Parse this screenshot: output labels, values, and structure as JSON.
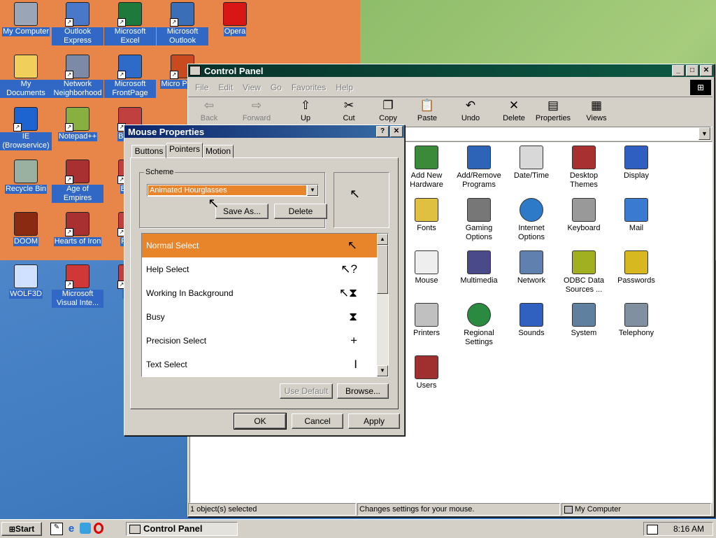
{
  "desktop": {
    "icons": [
      {
        "label": "My Computer",
        "icon": "computer-icon"
      },
      {
        "label": "Outlook Express",
        "icon": "outlook-express-icon"
      },
      {
        "label": "Microsoft Excel",
        "icon": "excel-icon"
      },
      {
        "label": "Microsoft Outlook",
        "icon": "outlook-icon"
      },
      {
        "label": "Opera",
        "icon": "opera-icon"
      },
      {
        "label": "My Documents",
        "icon": "folder-icon"
      },
      {
        "label": "Network Neighborhood",
        "icon": "network-icon"
      },
      {
        "label": "Microsoft FrontPage",
        "icon": "frontpage-icon"
      },
      {
        "label": "Micro Power",
        "icon": "powerpoint-icon"
      },
      {
        "label": "IE (Browservice)",
        "icon": "ie-icon"
      },
      {
        "label": "Notepad++",
        "icon": "notepad-icon"
      },
      {
        "label": "Bete D",
        "icon": "app-icon"
      },
      {
        "label": "Recycle Bin",
        "icon": "recycle-bin-icon"
      },
      {
        "label": "Age of Empires",
        "icon": "game-icon"
      },
      {
        "label": "Big D",
        "icon": "app-icon"
      },
      {
        "label": "DOOM",
        "icon": "doom-icon"
      },
      {
        "label": "Hearts of Iron",
        "icon": "game-icon"
      },
      {
        "label": "Pegg",
        "icon": "app-icon"
      },
      {
        "label": "WOLF3D",
        "icon": "wolf3d-icon"
      },
      {
        "label": "Microsoft Visual Inte...",
        "icon": "visual-icon"
      },
      {
        "label": "Pl Z",
        "icon": "app-icon"
      }
    ]
  },
  "control_panel": {
    "title": "Control Panel",
    "menu": [
      "File",
      "Edit",
      "View",
      "Go",
      "Favorites",
      "Help"
    ],
    "toolbar": [
      {
        "label": "Back",
        "icon": "back-arrow-icon",
        "enabled": false
      },
      {
        "label": "Forward",
        "icon": "forward-arrow-icon",
        "enabled": false
      },
      {
        "label": "Up",
        "icon": "up-folder-icon",
        "enabled": true
      },
      {
        "label": "Cut",
        "icon": "scissors-icon",
        "enabled": true
      },
      {
        "label": "Copy",
        "icon": "copy-icon",
        "enabled": true
      },
      {
        "label": "Paste",
        "icon": "paste-icon",
        "enabled": true
      },
      {
        "label": "Undo",
        "icon": "undo-icon",
        "enabled": true
      },
      {
        "label": "Delete",
        "icon": "delete-x-icon",
        "enabled": true
      },
      {
        "label": "Properties",
        "icon": "properties-icon",
        "enabled": true
      },
      {
        "label": "Views",
        "icon": "views-icon",
        "enabled": true
      }
    ],
    "items": [
      {
        "label": "Add New Hardware",
        "icon": "hardware-icon"
      },
      {
        "label": "Add/Remove Programs",
        "icon": "programs-icon"
      },
      {
        "label": "Date/Time",
        "icon": "calendar-icon"
      },
      {
        "label": "Desktop Themes",
        "icon": "themes-icon"
      },
      {
        "label": "Display",
        "icon": "display-icon"
      },
      {
        "label": "Fonts",
        "icon": "fonts-icon"
      },
      {
        "label": "Gaming Options",
        "icon": "joystick-icon"
      },
      {
        "label": "Internet Options",
        "icon": "globe-icon"
      },
      {
        "label": "Keyboard",
        "icon": "keyboard-icon"
      },
      {
        "label": "Mail",
        "icon": "mail-icon"
      },
      {
        "label": "Mouse",
        "icon": "mouse-icon"
      },
      {
        "label": "Multimedia",
        "icon": "multimedia-icon"
      },
      {
        "label": "Network",
        "icon": "network-icon"
      },
      {
        "label": "ODBC Data Sources ...",
        "icon": "odbc-icon"
      },
      {
        "label": "Passwords",
        "icon": "keys-icon"
      },
      {
        "label": "Printers",
        "icon": "printer-icon"
      },
      {
        "label": "Regional Settings",
        "icon": "globe-icon"
      },
      {
        "label": "Sounds",
        "icon": "speaker-icon"
      },
      {
        "label": "System",
        "icon": "computer-icon"
      },
      {
        "label": "Telephony",
        "icon": "phone-icon"
      },
      {
        "label": "Users",
        "icon": "users-icon"
      }
    ],
    "status": {
      "selected": "1 object(s) selected",
      "description": "Changes settings for your mouse.",
      "zone": "My Computer"
    }
  },
  "mouse_props": {
    "title": "Mouse Properties",
    "help_btn": "?",
    "close_btn": "✕",
    "tabs": [
      "Buttons",
      "Pointers",
      "Motion"
    ],
    "active_tab": "Pointers",
    "scheme_label": "Scheme",
    "scheme_value": "Animated Hourglasses",
    "save_as": "Save As...",
    "delete": "Delete",
    "pointers": [
      {
        "name": "Normal Select",
        "cursor": "↖"
      },
      {
        "name": "Help Select",
        "cursor": "↖?"
      },
      {
        "name": "Working In Background",
        "cursor": "↖⧗"
      },
      {
        "name": "Busy",
        "cursor": "⧗"
      },
      {
        "name": "Precision Select",
        "cursor": "+"
      },
      {
        "name": "Text Select",
        "cursor": "I"
      }
    ],
    "use_default": "Use Default",
    "browse": "Browse...",
    "ok": "OK",
    "cancel": "Cancel",
    "apply": "Apply"
  },
  "taskbar": {
    "start": "Start",
    "task": "Control Panel",
    "clock": "8:16 AM"
  }
}
